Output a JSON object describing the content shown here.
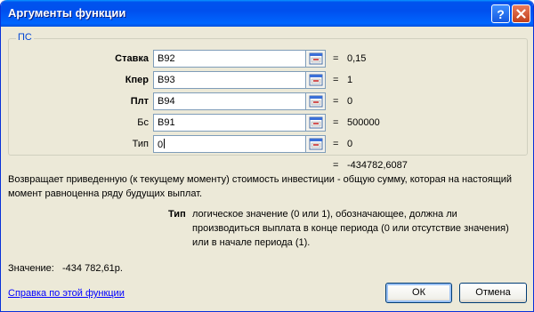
{
  "window": {
    "title": "Аргументы функции"
  },
  "function_name": "ПС",
  "arguments": [
    {
      "label": "Ставка",
      "bold": true,
      "ref": "B92",
      "value": "0,15"
    },
    {
      "label": "Кпер",
      "bold": true,
      "ref": "B93",
      "value": "1"
    },
    {
      "label": "Плт",
      "bold": true,
      "ref": "B94",
      "value": "0"
    },
    {
      "label": "Бс",
      "bold": false,
      "ref": "B91",
      "value": "500000"
    },
    {
      "label": "Тип",
      "bold": false,
      "ref": "0",
      "value": "0"
    }
  ],
  "equals_sign": "=",
  "formula_result": "-434782,6087",
  "description": "Возвращает приведенную (к текущему моменту) стоимость инвестиции - общую сумму, которая на настоящий момент равноценна ряду будущих выплат.",
  "param_help": {
    "name": "Тип",
    "text": "логическое значение (0 или 1), обозначающее, должна ли производиться выплата в конце периода (0 или отсутствие значения) или в начале периода (1)."
  },
  "result": {
    "label": "Значение:",
    "value": "-434 782,61р."
  },
  "help_link": "Справка по этой функции",
  "buttons": {
    "ok": "ОК",
    "cancel": "Отмена"
  },
  "colors": {
    "titlebar": "#0053ee",
    "legend": "#0046d5",
    "link": "#0000ff"
  },
  "icons": [
    "help-icon",
    "close-icon",
    "collapse-dialog-icon"
  ]
}
